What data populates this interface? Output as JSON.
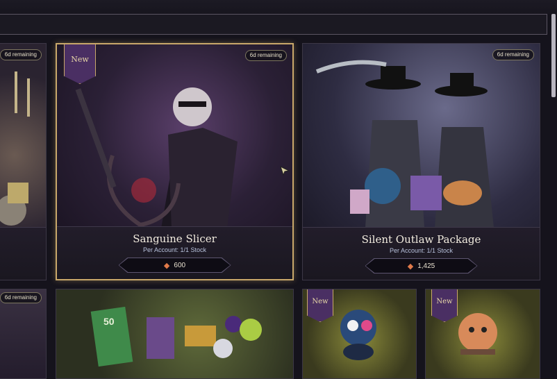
{
  "store": {
    "cards": [
      {
        "timer": "6d remaining"
      },
      {
        "badge": "New",
        "timer": "6d remaining",
        "title": "Sanguine Slicer",
        "stock": "Per Account:   1/1 Stock",
        "price": "600"
      },
      {
        "timer": "6d remaining",
        "title": "Silent Outlaw Package",
        "stock": "Per Account:   1/1 Stock",
        "price": "1,425"
      },
      {
        "timer": "6d remaining"
      },
      {},
      {
        "badge": "New"
      },
      {
        "badge": "New"
      }
    ],
    "bundle_card_number": "50"
  },
  "colors": {
    "accent_gold": "#c9a86a",
    "badge_purple": "#4a2f63",
    "price_icon": "#e07a4a"
  },
  "icons": {
    "price": "crystal-currency-icon",
    "cursor": "pointer-cursor-icon"
  }
}
